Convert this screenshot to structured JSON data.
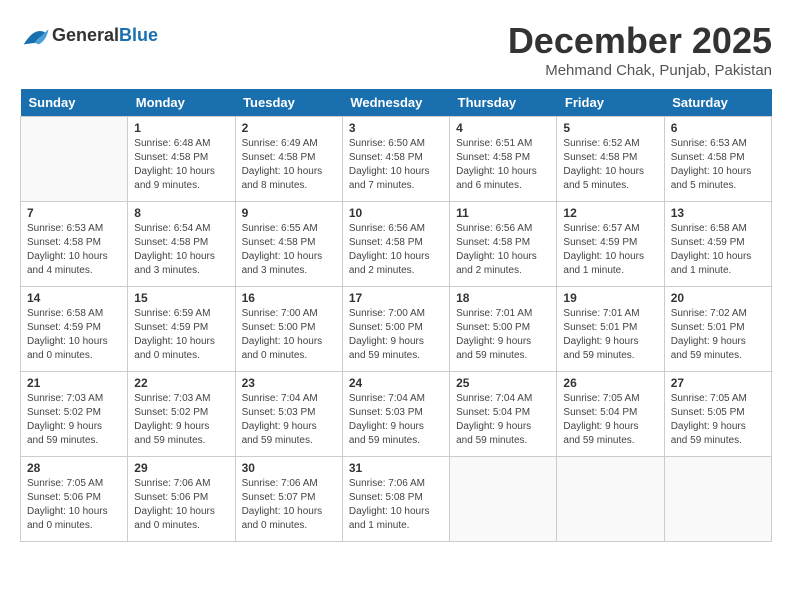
{
  "header": {
    "logo_general": "General",
    "logo_blue": "Blue",
    "month": "December 2025",
    "location": "Mehmand Chak, Punjab, Pakistan"
  },
  "weekdays": [
    "Sunday",
    "Monday",
    "Tuesday",
    "Wednesday",
    "Thursday",
    "Friday",
    "Saturday"
  ],
  "weeks": [
    [
      {
        "day": "",
        "sunrise": "",
        "sunset": "",
        "daylight": ""
      },
      {
        "day": "1",
        "sunrise": "Sunrise: 6:48 AM",
        "sunset": "Sunset: 4:58 PM",
        "daylight": "Daylight: 10 hours and 9 minutes."
      },
      {
        "day": "2",
        "sunrise": "Sunrise: 6:49 AM",
        "sunset": "Sunset: 4:58 PM",
        "daylight": "Daylight: 10 hours and 8 minutes."
      },
      {
        "day": "3",
        "sunrise": "Sunrise: 6:50 AM",
        "sunset": "Sunset: 4:58 PM",
        "daylight": "Daylight: 10 hours and 7 minutes."
      },
      {
        "day": "4",
        "sunrise": "Sunrise: 6:51 AM",
        "sunset": "Sunset: 4:58 PM",
        "daylight": "Daylight: 10 hours and 6 minutes."
      },
      {
        "day": "5",
        "sunrise": "Sunrise: 6:52 AM",
        "sunset": "Sunset: 4:58 PM",
        "daylight": "Daylight: 10 hours and 5 minutes."
      },
      {
        "day": "6",
        "sunrise": "Sunrise: 6:53 AM",
        "sunset": "Sunset: 4:58 PM",
        "daylight": "Daylight: 10 hours and 5 minutes."
      }
    ],
    [
      {
        "day": "7",
        "sunrise": "Sunrise: 6:53 AM",
        "sunset": "Sunset: 4:58 PM",
        "daylight": "Daylight: 10 hours and 4 minutes."
      },
      {
        "day": "8",
        "sunrise": "Sunrise: 6:54 AM",
        "sunset": "Sunset: 4:58 PM",
        "daylight": "Daylight: 10 hours and 3 minutes."
      },
      {
        "day": "9",
        "sunrise": "Sunrise: 6:55 AM",
        "sunset": "Sunset: 4:58 PM",
        "daylight": "Daylight: 10 hours and 3 minutes."
      },
      {
        "day": "10",
        "sunrise": "Sunrise: 6:56 AM",
        "sunset": "Sunset: 4:58 PM",
        "daylight": "Daylight: 10 hours and 2 minutes."
      },
      {
        "day": "11",
        "sunrise": "Sunrise: 6:56 AM",
        "sunset": "Sunset: 4:58 PM",
        "daylight": "Daylight: 10 hours and 2 minutes."
      },
      {
        "day": "12",
        "sunrise": "Sunrise: 6:57 AM",
        "sunset": "Sunset: 4:59 PM",
        "daylight": "Daylight: 10 hours and 1 minute."
      },
      {
        "day": "13",
        "sunrise": "Sunrise: 6:58 AM",
        "sunset": "Sunset: 4:59 PM",
        "daylight": "Daylight: 10 hours and 1 minute."
      }
    ],
    [
      {
        "day": "14",
        "sunrise": "Sunrise: 6:58 AM",
        "sunset": "Sunset: 4:59 PM",
        "daylight": "Daylight: 10 hours and 0 minutes."
      },
      {
        "day": "15",
        "sunrise": "Sunrise: 6:59 AM",
        "sunset": "Sunset: 4:59 PM",
        "daylight": "Daylight: 10 hours and 0 minutes."
      },
      {
        "day": "16",
        "sunrise": "Sunrise: 7:00 AM",
        "sunset": "Sunset: 5:00 PM",
        "daylight": "Daylight: 10 hours and 0 minutes."
      },
      {
        "day": "17",
        "sunrise": "Sunrise: 7:00 AM",
        "sunset": "Sunset: 5:00 PM",
        "daylight": "Daylight: 9 hours and 59 minutes."
      },
      {
        "day": "18",
        "sunrise": "Sunrise: 7:01 AM",
        "sunset": "Sunset: 5:00 PM",
        "daylight": "Daylight: 9 hours and 59 minutes."
      },
      {
        "day": "19",
        "sunrise": "Sunrise: 7:01 AM",
        "sunset": "Sunset: 5:01 PM",
        "daylight": "Daylight: 9 hours and 59 minutes."
      },
      {
        "day": "20",
        "sunrise": "Sunrise: 7:02 AM",
        "sunset": "Sunset: 5:01 PM",
        "daylight": "Daylight: 9 hours and 59 minutes."
      }
    ],
    [
      {
        "day": "21",
        "sunrise": "Sunrise: 7:03 AM",
        "sunset": "Sunset: 5:02 PM",
        "daylight": "Daylight: 9 hours and 59 minutes."
      },
      {
        "day": "22",
        "sunrise": "Sunrise: 7:03 AM",
        "sunset": "Sunset: 5:02 PM",
        "daylight": "Daylight: 9 hours and 59 minutes."
      },
      {
        "day": "23",
        "sunrise": "Sunrise: 7:04 AM",
        "sunset": "Sunset: 5:03 PM",
        "daylight": "Daylight: 9 hours and 59 minutes."
      },
      {
        "day": "24",
        "sunrise": "Sunrise: 7:04 AM",
        "sunset": "Sunset: 5:03 PM",
        "daylight": "Daylight: 9 hours and 59 minutes."
      },
      {
        "day": "25",
        "sunrise": "Sunrise: 7:04 AM",
        "sunset": "Sunset: 5:04 PM",
        "daylight": "Daylight: 9 hours and 59 minutes."
      },
      {
        "day": "26",
        "sunrise": "Sunrise: 7:05 AM",
        "sunset": "Sunset: 5:04 PM",
        "daylight": "Daylight: 9 hours and 59 minutes."
      },
      {
        "day": "27",
        "sunrise": "Sunrise: 7:05 AM",
        "sunset": "Sunset: 5:05 PM",
        "daylight": "Daylight: 9 hours and 59 minutes."
      }
    ],
    [
      {
        "day": "28",
        "sunrise": "Sunrise: 7:05 AM",
        "sunset": "Sunset: 5:06 PM",
        "daylight": "Daylight: 10 hours and 0 minutes."
      },
      {
        "day": "29",
        "sunrise": "Sunrise: 7:06 AM",
        "sunset": "Sunset: 5:06 PM",
        "daylight": "Daylight: 10 hours and 0 minutes."
      },
      {
        "day": "30",
        "sunrise": "Sunrise: 7:06 AM",
        "sunset": "Sunset: 5:07 PM",
        "daylight": "Daylight: 10 hours and 0 minutes."
      },
      {
        "day": "31",
        "sunrise": "Sunrise: 7:06 AM",
        "sunset": "Sunset: 5:08 PM",
        "daylight": "Daylight: 10 hours and 1 minute."
      },
      {
        "day": "",
        "sunrise": "",
        "sunset": "",
        "daylight": ""
      },
      {
        "day": "",
        "sunrise": "",
        "sunset": "",
        "daylight": ""
      },
      {
        "day": "",
        "sunrise": "",
        "sunset": "",
        "daylight": ""
      }
    ]
  ]
}
